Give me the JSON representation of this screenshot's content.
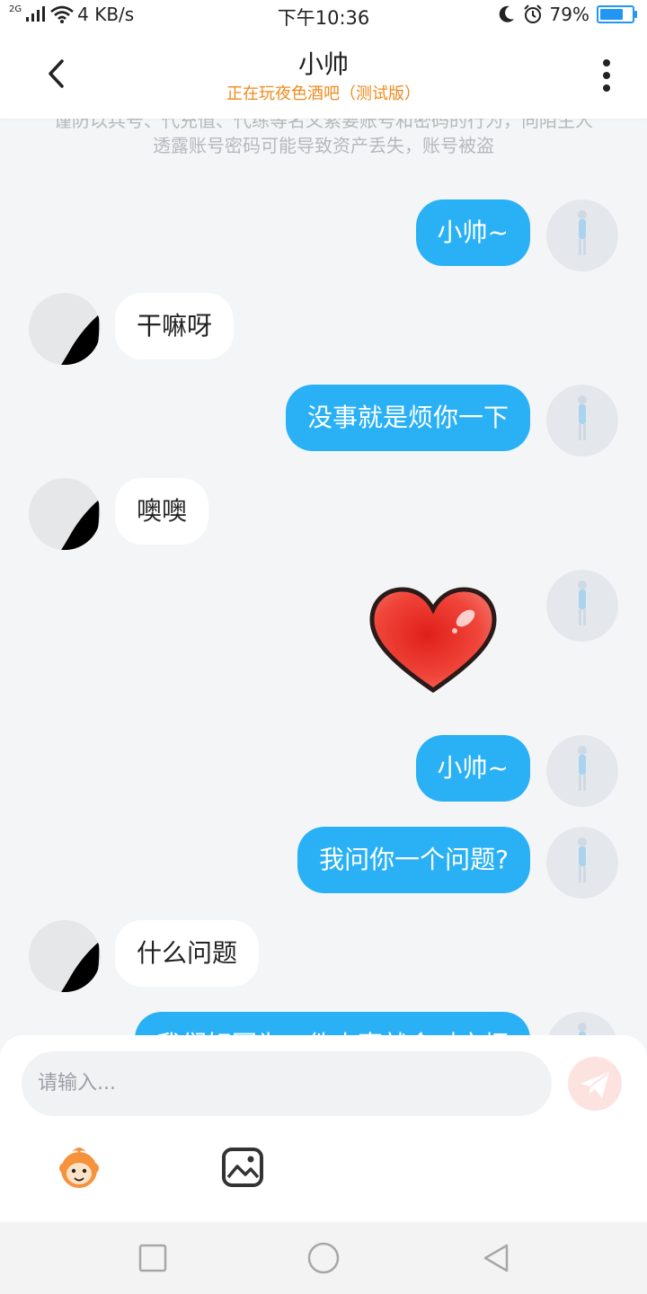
{
  "status_bar": {
    "network": "2G",
    "speed": "4 KB/s",
    "time": "下午10:36",
    "battery_level": 0.79,
    "battery_text": "79%"
  },
  "header": {
    "title": "小帅",
    "subtitle": "正在玩夜色酒吧（测试版）",
    "subtitle_color": "#f08a1c"
  },
  "chat": {
    "notice": "谨防以兵号、代充值、代练等名义索要账号和密码的行为，向陌生人透露账号密码可能导致资产丢失，账号被盗",
    "messages": [
      {
        "from": "me",
        "type": "text",
        "text": "小帅~"
      },
      {
        "from": "other",
        "type": "text",
        "text": "干嘛呀"
      },
      {
        "from": "me",
        "type": "text",
        "text": "没事就是烦你一下"
      },
      {
        "from": "other",
        "type": "text",
        "text": "噢噢"
      },
      {
        "from": "me",
        "type": "sticker",
        "sticker": "heart-sticker"
      },
      {
        "from": "me",
        "type": "text",
        "text": "小帅~"
      },
      {
        "from": "me",
        "type": "text",
        "text": "我问你一个问题?"
      },
      {
        "from": "other",
        "type": "text",
        "text": "什么问题"
      },
      {
        "from": "me",
        "type": "text",
        "text": "我们好因为一件小事就会对方烦"
      }
    ]
  },
  "composer": {
    "placeholder": "请输入..."
  },
  "colors": {
    "my_bubble": "#2ab1f5",
    "accent": "#f08a1c",
    "background": "#f4f5f7"
  }
}
